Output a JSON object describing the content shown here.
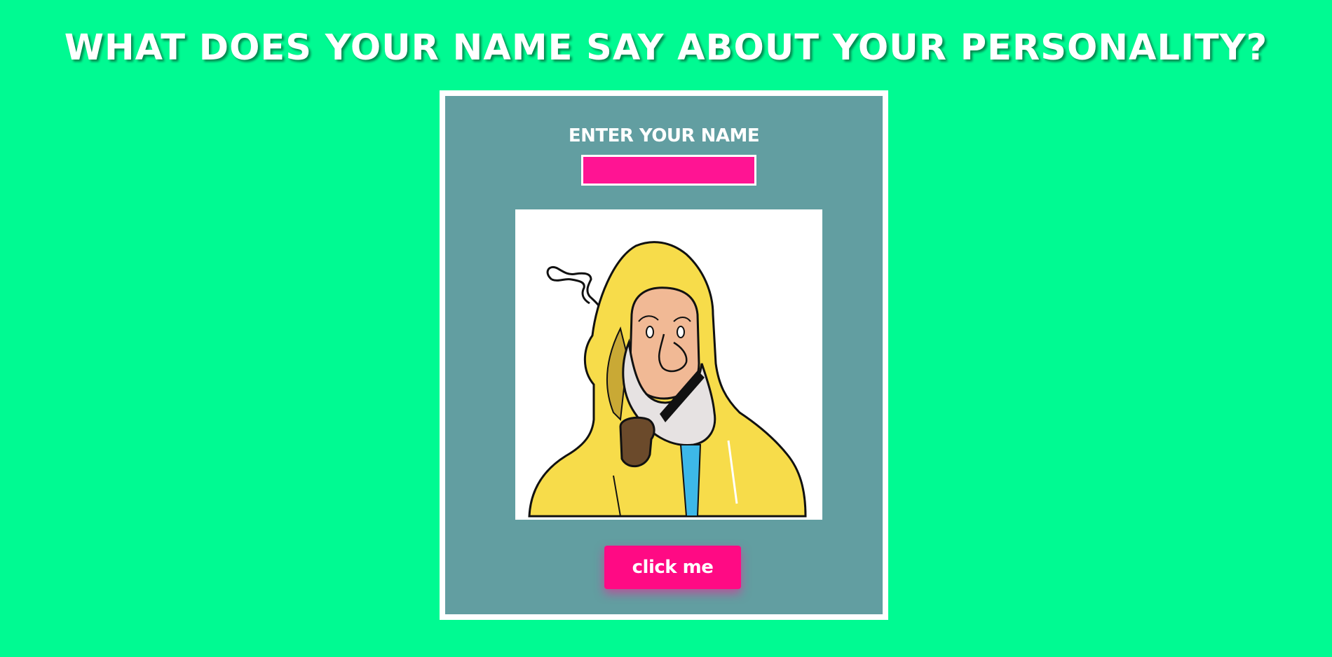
{
  "header": {
    "title": "WHAT DOES YOUR NAME SAY ABOUT YOUR PERSONALITY?"
  },
  "form": {
    "label": "ENTER YOUR NAME",
    "input_value": "",
    "button_label": "click me"
  },
  "illustration": {
    "icon": "fisherman-illustration"
  },
  "colors": {
    "background": "#00fa92",
    "card": "#629ea1",
    "accent": "#ff1493",
    "raincoat": "#f7dc4a",
    "skin": "#f1b995",
    "beard": "#e6e2e2",
    "pipe": "#6b4a2b",
    "shirt": "#3db8e8"
  }
}
